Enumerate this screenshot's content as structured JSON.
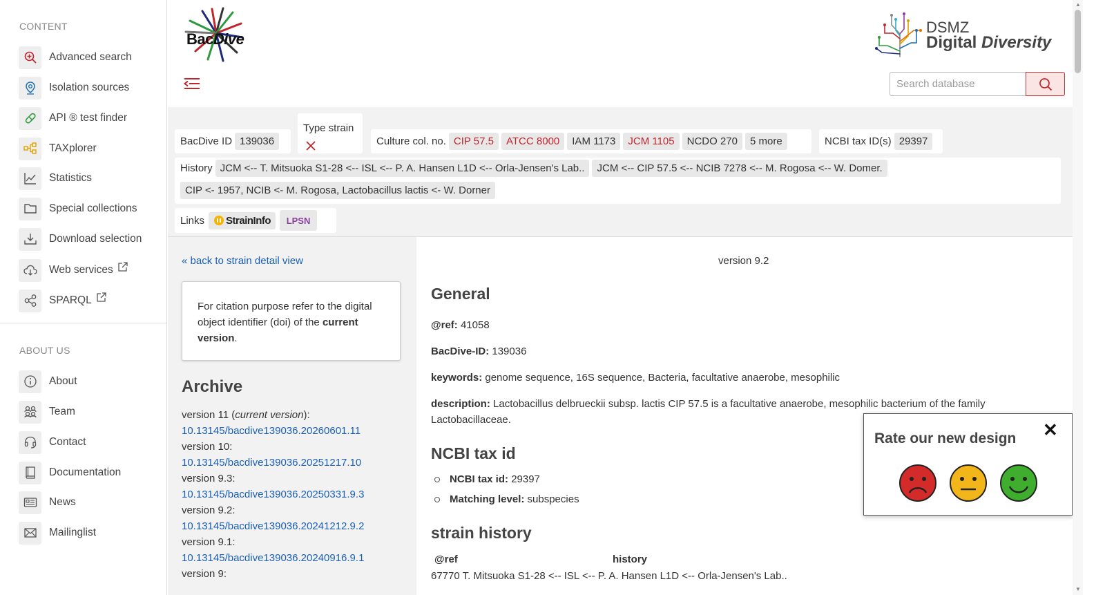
{
  "sidebar": {
    "content_title": "CONTENT",
    "about_title": "ABOUT US",
    "content_items": [
      {
        "label": "Advanced search",
        "icon": "search-plus-icon"
      },
      {
        "label": "Isolation sources",
        "icon": "map-pin-icon"
      },
      {
        "label": "API ® test finder",
        "icon": "pill-icon"
      },
      {
        "label": "TAXplorer",
        "icon": "hierarchy-icon"
      },
      {
        "label": "Statistics",
        "icon": "line-chart-icon"
      },
      {
        "label": "Special collections",
        "icon": "folder-icon"
      },
      {
        "label": "Download selection",
        "icon": "download-icon"
      },
      {
        "label": "Web services",
        "icon": "cloud-download-icon"
      },
      {
        "label": "SPARQL",
        "icon": "share-nodes-icon"
      }
    ],
    "about_items": [
      {
        "label": "About",
        "icon": "info-icon"
      },
      {
        "label": "Team",
        "icon": "team-icon"
      },
      {
        "label": "Contact",
        "icon": "headset-icon"
      },
      {
        "label": "Documentation",
        "icon": "book-icon"
      },
      {
        "label": "News",
        "icon": "newspaper-icon"
      },
      {
        "label": "Mailinglist",
        "icon": "mail-icon"
      }
    ]
  },
  "header": {
    "logo_text_bac": "Bac",
    "logo_text_dive": "Dive",
    "dsmz_line1": "DSMZ",
    "dsmz_line2a": "Digital ",
    "dsmz_line2b": "Diversity",
    "search_placeholder": "Search database"
  },
  "info": {
    "bacdive_id_label": "BacDive ID",
    "bacdive_id": "139036",
    "type_strain_label": "Type strain",
    "culture_label": "Culture col. no.",
    "culture_chips": [
      {
        "text": "CIP 57.5",
        "red": true
      },
      {
        "text": "ATCC 8000",
        "red": true
      },
      {
        "text": "IAM 1173",
        "red": false
      },
      {
        "text": "JCM 1105",
        "red": true
      },
      {
        "text": "NCDO 270",
        "red": false
      },
      {
        "text": "5 more",
        "red": false
      }
    ],
    "ncbi_label": "NCBI tax ID(s)",
    "ncbi_id": "29397",
    "history_label": "History",
    "history_chips": [
      "JCM <-- T. Mitsuoka S1-28 <-- ISL <-- P. A. Hansen L1D <-- Orla-Jensen's Lab..",
      "JCM <-- CIP 57.5 <-- NCIB 7278 <-- M. Rogosa <-- W. Domer.",
      "CIP <- 1957, NCIB <- M. Rogosa, Lactobacillus lactis <- W. Dorner"
    ],
    "links_label": "Links",
    "straininfo": "StrainInfo",
    "lpsn": "LPSN"
  },
  "left": {
    "back_link": "« back to strain detail view",
    "cite_text_1": "For citation purpose refer to the digital object identifier (doi) of the ",
    "cite_bold": "current version",
    "cite_end": ".",
    "archive_title": "Archive",
    "versions": [
      {
        "label": "version 11 (",
        "italic": "current version",
        "suffix": "):",
        "doi": "10.13145/bacdive139036.20260601.11"
      },
      {
        "label": "version 10:",
        "italic": "",
        "suffix": "",
        "doi": "10.13145/bacdive139036.20251217.10"
      },
      {
        "label": "version 9.3:",
        "italic": "",
        "suffix": "",
        "doi": "10.13145/bacdive139036.20250331.9.3"
      },
      {
        "label": "version 9.2:",
        "italic": "",
        "suffix": "",
        "doi": "10.13145/bacdive139036.20241212.9.2"
      },
      {
        "label": "version 9.1:",
        "italic": "",
        "suffix": "",
        "doi": "10.13145/bacdive139036.20240916.9.1"
      },
      {
        "label": "version 9:",
        "italic": "",
        "suffix": "",
        "doi": ""
      }
    ]
  },
  "main": {
    "version": "version 9.2",
    "general_title": "General",
    "ref_label": "@ref:",
    "ref_value": "41058",
    "bacdive_label": "BacDive-ID:",
    "bacdive_value": "139036",
    "keywords_label": "keywords:",
    "keywords_value": "genome sequence, 16S sequence, Bacteria, facultative anaerobe, mesophilic",
    "description_label": "description:",
    "description_value": "Lactobacillus delbrueckii subsp. lactis CIP 57.5 is a facultative anaerobe, mesophilic bacterium of the family Lactobacillaceae.",
    "ncbi_title": "NCBI tax id",
    "ncbi_taxid_label": "NCBI tax id:",
    "ncbi_taxid_value": "29397",
    "matching_label": "Matching level:",
    "matching_value": "subspecies",
    "history_title": "strain history",
    "col_ref": "@ref",
    "col_history": "history",
    "history_row_ref": "67770",
    "history_row_text": "T. Mitsuoka S1-28 <-- ISL <-- P. A. Hansen L1D <-- Orla-Jensen's Lab.."
  },
  "rate": {
    "title": "Rate our new design",
    "close": "✕",
    "faces": [
      "sad-face-icon",
      "neutral-face-icon",
      "happy-face-icon"
    ]
  },
  "colors": {
    "accent_red": "#c0252b",
    "link_blue": "#1a5fb4",
    "band_grey": "#f2f2f2"
  }
}
